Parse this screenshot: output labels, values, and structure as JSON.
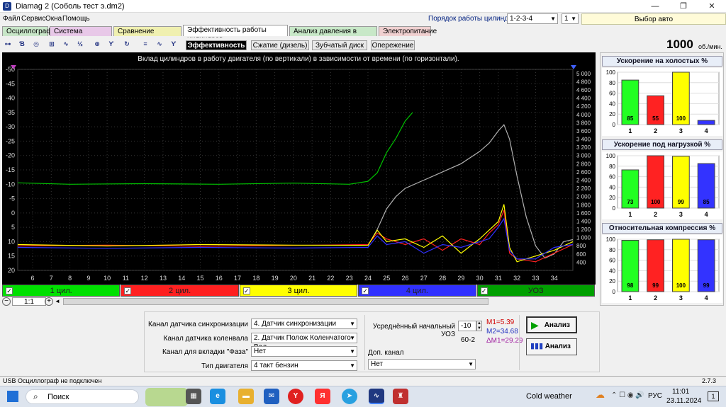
{
  "window": {
    "title": "Diamag 2 (Соболь тест э.dm2)",
    "app_icon_letter": "D"
  },
  "menu": [
    "Файл",
    "Сервис",
    "Окна",
    "Помощь"
  ],
  "cylinder_order": {
    "label": "Порядок работы цилиндров",
    "value": "1-2-3-4",
    "count": "1",
    "auto": "Выбор авто"
  },
  "tabs": [
    {
      "label": "Осциллограф",
      "color": "#c8e6c8"
    },
    {
      "label": "Система зажигания",
      "color": "#e8c8e8"
    },
    {
      "label": "Сравнение цилиндров",
      "color": "#f0f0b0"
    },
    {
      "label": "Эффективность работы цилиндров",
      "color": "#ffffff"
    },
    {
      "label": "Анализ давления в цилиндре",
      "color": "#c8e8c8"
    },
    {
      "label": "Электропитание",
      "color": "#f0d0d0"
    }
  ],
  "subtabs": [
    "Эффективность",
    "Сжатие (дизель)",
    "Зубчатый диск",
    "Опережение"
  ],
  "toolbar_icons": [
    "oscillator-icon",
    "ignition-icon",
    "rpm-icon",
    "scope-icon",
    "waveform-icon",
    "measure-icon",
    "zoom-icon",
    "filter-icon",
    "reset-icon",
    "stats-icon",
    "graph-icon",
    "marker-icon"
  ],
  "rpm": {
    "value": "1000",
    "unit": "об./мин."
  },
  "chart_data": {
    "type": "line",
    "title": "Вклад цилиндров в работу двигателя (по вертикали) в зависимости от времени (по горизонтали).",
    "x_ticks": [
      "6",
      "7",
      "8",
      "9",
      "10",
      "11",
      "12",
      "13",
      "14",
      "15",
      "16",
      "17",
      "18",
      "19",
      "20",
      "21",
      "22",
      "23",
      "24",
      "25",
      "26",
      "27",
      "28",
      "29",
      "30",
      "31",
      "32",
      "33",
      "34"
    ],
    "y_left_ticks": [
      "-50",
      "-45",
      "-40",
      "-35",
      "-30",
      "-25",
      "-20",
      "-15",
      "-10",
      "-5",
      "0",
      "5",
      "10",
      "15",
      "20"
    ],
    "y_right_ticks": [
      "5 000",
      "4 800",
      "4 600",
      "4 400",
      "4 200",
      "4 000",
      "3 800",
      "3 600",
      "3 400",
      "3 200",
      "3 000",
      "2 800",
      "2 600",
      "2 400",
      "2 200",
      "2 000",
      "1 800",
      "1 600",
      "1 400",
      "1 200",
      "1 000",
      "800",
      "600",
      "400"
    ],
    "xlim": [
      5.2,
      35
    ],
    "ylim_left": [
      -50,
      20
    ],
    "ylim_right": [
      200,
      5100
    ],
    "series": [
      {
        "color": "#00c000",
        "points": [
          [
            5.2,
            -10.5
          ],
          [
            8,
            -10
          ],
          [
            12,
            -10.2
          ],
          [
            16,
            -10
          ],
          [
            20,
            -10.4
          ],
          [
            23,
            -10
          ],
          [
            24,
            -11
          ],
          [
            24.5,
            -14
          ],
          [
            25,
            -21
          ],
          [
            25.5,
            -26
          ],
          [
            26,
            -32
          ],
          [
            26.4,
            -35
          ]
        ]
      },
      {
        "color": "#b0b0b0",
        "axis": "right",
        "points": [
          [
            24,
            800
          ],
          [
            24.5,
            1200
          ],
          [
            25,
            1700
          ],
          [
            25.5,
            2000
          ],
          [
            26,
            2200
          ],
          [
            27,
            2400
          ],
          [
            28,
            2600
          ],
          [
            29,
            2800
          ],
          [
            30,
            3100
          ],
          [
            30.5,
            3300
          ],
          [
            31,
            3600
          ],
          [
            31.3,
            3750
          ],
          [
            31.6,
            3400
          ],
          [
            32,
            2500
          ],
          [
            32.5,
            1500
          ],
          [
            33,
            800
          ],
          [
            33.5,
            500
          ],
          [
            34,
            600
          ],
          [
            34.5,
            900
          ],
          [
            35,
            950
          ]
        ]
      },
      {
        "color": "#ff2020",
        "points": [
          [
            5.2,
            11.5
          ],
          [
            10,
            11.2
          ],
          [
            15,
            11.6
          ],
          [
            20,
            11.3
          ],
          [
            24,
            11
          ],
          [
            24.5,
            7
          ],
          [
            25,
            9
          ],
          [
            26,
            11
          ],
          [
            27,
            9
          ],
          [
            28,
            13
          ],
          [
            29,
            9
          ],
          [
            30,
            11
          ],
          [
            30.5,
            7
          ],
          [
            31,
            4
          ],
          [
            31.3,
            -1
          ],
          [
            31.6,
            14
          ],
          [
            32,
            16
          ],
          [
            33,
            17
          ],
          [
            34,
            14
          ],
          [
            35,
            11
          ]
        ]
      },
      {
        "color": "#ffff00",
        "points": [
          [
            5.2,
            11
          ],
          [
            10,
            11.5
          ],
          [
            15,
            11
          ],
          [
            20,
            11.2
          ],
          [
            24,
            11.3
          ],
          [
            24.5,
            6
          ],
          [
            25,
            10
          ],
          [
            26,
            9
          ],
          [
            27,
            12
          ],
          [
            28,
            8
          ],
          [
            29,
            14
          ],
          [
            30,
            9
          ],
          [
            30.5,
            6
          ],
          [
            31,
            3
          ],
          [
            31.3,
            -3
          ],
          [
            31.6,
            12
          ],
          [
            32,
            17
          ],
          [
            33,
            15
          ],
          [
            34,
            13
          ],
          [
            35,
            10
          ]
        ]
      },
      {
        "color": "#3030ff",
        "points": [
          [
            5.2,
            12
          ],
          [
            10,
            12.3
          ],
          [
            15,
            12
          ],
          [
            20,
            12.2
          ],
          [
            24,
            12
          ],
          [
            24.5,
            8
          ],
          [
            25,
            11
          ],
          [
            26,
            10
          ],
          [
            27,
            14
          ],
          [
            28,
            11
          ],
          [
            29,
            12
          ],
          [
            30,
            10
          ],
          [
            30.5,
            9
          ],
          [
            31,
            5
          ],
          [
            31.3,
            2
          ],
          [
            31.6,
            13
          ],
          [
            32,
            16
          ],
          [
            33,
            16
          ],
          [
            34,
            12
          ],
          [
            35,
            11
          ]
        ]
      }
    ]
  },
  "legend": [
    {
      "label": "1 цил.",
      "color": "#00e000"
    },
    {
      "label": "2 цил.",
      "color": "#ff2020"
    },
    {
      "label": "3 цил.",
      "color": "#ffff00"
    },
    {
      "label": "4 цил.",
      "color": "#3030ff"
    },
    {
      "label": "УОЗ",
      "color": "#00a000"
    }
  ],
  "scale": "1:1",
  "panels": [
    {
      "title": "Ускорение на холостых %",
      "values": [
        85,
        55,
        100,
        8
      ],
      "labels": [
        "85",
        "55",
        "100",
        ""
      ]
    },
    {
      "title": "Ускорение под нагрузкой %",
      "values": [
        73,
        100,
        99,
        85
      ],
      "labels": [
        "73",
        "100",
        "99",
        "85"
      ]
    },
    {
      "title": "Относительная компрессия %",
      "values": [
        98,
        99,
        100,
        99
      ],
      "labels": [
        "98",
        "99",
        "100",
        "99"
      ]
    }
  ],
  "panel_cats": [
    "1",
    "2",
    "3",
    "4"
  ],
  "panel_yticks": [
    "100",
    "80",
    "60",
    "40",
    "20",
    "0"
  ],
  "bar_colors": [
    "#22ff22",
    "#ff2222",
    "#ffff00",
    "#3333ff"
  ],
  "settings": {
    "sync_label": "Канал датчика синхронизации",
    "sync_value": "4.  Датчик синхронизации",
    "crank_label": "Канал датчика коленвала",
    "crank_value": "2.  Датчик Полож Коленчатого Вал",
    "phase_label": "Канал для вкладки \"Фаза\"",
    "phase_value": "Нет",
    "engine_label": "Тип двигателя",
    "engine_value": "4 такт бензин",
    "uoz_label": "Усреднённый начальный УОЗ",
    "uoz_value": "-10",
    "disk": "60-2",
    "extra_label": "Доп. канал",
    "extra_value": "Нет",
    "m1": "M1=5.39",
    "m2": "M2=34.68",
    "dm": "ΔM1=29.29",
    "analyze": "Анализ"
  },
  "status": {
    "left": "USB Осциллограф не подключен",
    "version": "2.7.3"
  },
  "taskbar": {
    "search": "Поиск",
    "weather": "Cold weather",
    "lang": "РУС",
    "time": "11:01",
    "date": "23.11.2024",
    "notif": "1"
  }
}
